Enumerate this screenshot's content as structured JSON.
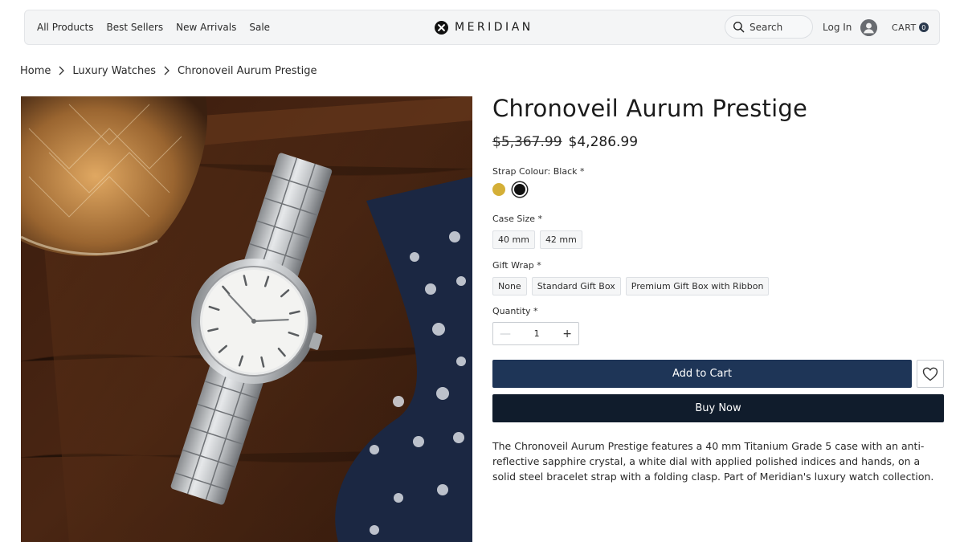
{
  "nav": {
    "links": [
      "All Products",
      "Best Sellers",
      "New Arrivals",
      "Sale"
    ]
  },
  "brand": {
    "name": "MERIDIAN"
  },
  "header": {
    "search_label": "Search",
    "login_label": "Log In",
    "cart_label": "CART",
    "cart_count": "0"
  },
  "breadcrumb": {
    "items": [
      "Home",
      "Luxury Watches",
      "Chronoveil Aurum Prestige"
    ]
  },
  "product": {
    "title": "Chronoveil Aurum Prestige",
    "old_price": "$5,367.99",
    "price": "$4,286.99",
    "strap_label": "Strap Colour: Black *",
    "strap_options": [
      {
        "name": "Gold",
        "color": "#d4af37"
      },
      {
        "name": "Black",
        "color": "#111111",
        "selected": true
      }
    ],
    "case_size_label": "Case Size *",
    "case_sizes": [
      "40 mm",
      "42 mm"
    ],
    "gift_wrap_label": "Gift Wrap *",
    "gift_wrap_options": [
      "None",
      "Standard Gift Box",
      "Premium Gift Box with Ribbon"
    ],
    "quantity_label": "Quantity *",
    "quantity": "1",
    "add_to_cart_label": "Add to Cart",
    "buy_now_label": "Buy Now",
    "description": "The Chronoveil Aurum Prestige features a 40 mm Titanium Grade 5 case with an anti-reflective sapphire crystal, a white dial with applied polished indices and hands, on a solid steel bracelet strap with a folding clasp. Part of Meridian's luxury watch collection."
  },
  "colors": {
    "primary_button": "#1e3557",
    "buy_now_button": "#101c2c",
    "header_bg": "#f4f5f6"
  },
  "icons": {
    "logo": "meridian-x-logo-icon",
    "search": "search-icon",
    "user": "user-avatar-icon",
    "breadcrumb_separator": "chevron-right-icon",
    "wishlist": "heart-icon",
    "qty_minus": "minus-icon",
    "qty_plus": "plus-icon"
  }
}
